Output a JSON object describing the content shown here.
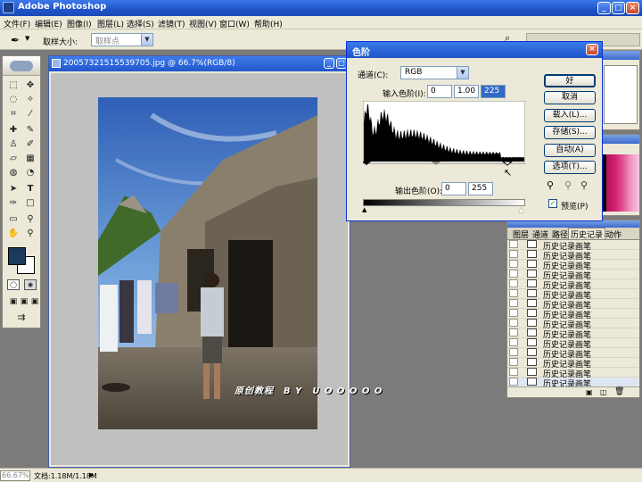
{
  "app": {
    "title": "Adobe Photoshop"
  },
  "menu": [
    "文件(F)",
    "编辑(E)",
    "图像(I)",
    "图层(L)",
    "选择(S)",
    "滤镜(T)",
    "视图(V)",
    "窗口(W)",
    "帮助(H)"
  ],
  "options_bar": {
    "sample_size_label": "取样大小:",
    "sample_size_value": "取样点"
  },
  "document": {
    "title": "20057321515539705.jpg @ 66.7%(RGB/8)"
  },
  "levels": {
    "title": "色阶",
    "channel_label": "通道(C):",
    "channel_value": "RGB",
    "input_label": "输入色阶(I):",
    "input_black": "0",
    "input_gamma": "1.00",
    "input_white": "225",
    "output_label": "输出色阶(O):",
    "output_black": "0",
    "output_white": "255",
    "buttons": {
      "ok": "好",
      "cancel": "取消",
      "load": "载入(L)...",
      "save": "存储(S)...",
      "auto": "自动(A)",
      "options": "选项(T)..."
    },
    "preview_label": "预览(P)",
    "preview_checked": true
  },
  "history_panel": {
    "tabs": [
      "图层",
      "通道",
      "路径",
      "历史记录",
      "动作"
    ],
    "items": [
      "历史记录画笔",
      "历史记录画笔",
      "历史记录画笔",
      "历史记录画笔",
      "历史记录画笔",
      "历史记录画笔",
      "历史记录画笔",
      "历史记录画笔",
      "历史记录画笔",
      "历史记录画笔",
      "历史记录画笔",
      "历史记录画笔",
      "历史记录画笔",
      "历史记录画笔",
      "历史记录画笔"
    ]
  },
  "watermark": {
    "text": "原创教程　B Y　U O O O O O"
  },
  "status": {
    "zoom": "66.67%",
    "doc_size": "文档:1.18M/1.18M"
  },
  "colors": {
    "foreground": "#1c3a5c",
    "background": "#ffffff",
    "accent": "#2256cc"
  }
}
